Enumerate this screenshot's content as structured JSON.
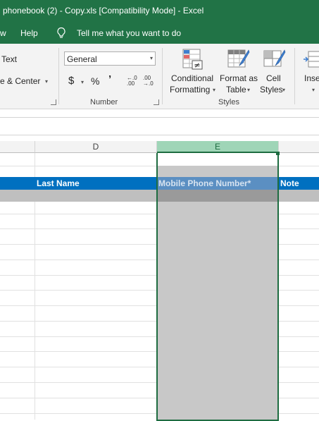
{
  "window": {
    "title": "phonebook (2) - Copy.xls  [Compatibility Mode]  -  Excel"
  },
  "menu": {
    "items": [
      "w",
      "Help"
    ],
    "tell_me": "Tell me what you want to do"
  },
  "ribbon": {
    "alignment": {
      "wrap_text": "Text",
      "merge_center": "e & Center"
    },
    "number": {
      "format_value": "General",
      "currency_symbol": "$",
      "percent_symbol": "%",
      "comma_symbol": "’",
      "increase_decimal": "←.0\n.00",
      "decrease_decimal": ".00\n→.0",
      "group_label": "Number"
    },
    "styles": {
      "conditional_formatting": [
        "Conditional",
        "Formatting"
      ],
      "format_as_table": [
        "Format as",
        "Table"
      ],
      "cell_styles": [
        "Cell",
        "Styles"
      ],
      "group_label": "Styles"
    },
    "cells": {
      "insert": "Inse"
    }
  },
  "sheet": {
    "columns": [
      "D",
      "E"
    ],
    "selected_column": "E",
    "header_row": {
      "last_name": "Last Name",
      "mobile_phone": "Mobile Phone Number*",
      "note": "Note"
    }
  },
  "colors": {
    "excel_green": "#217346",
    "header_blue": "#0070C0",
    "selection_border": "#1E6C41",
    "selected_header": "#9FD5B7",
    "selection_fill": "#C8C8C8"
  }
}
